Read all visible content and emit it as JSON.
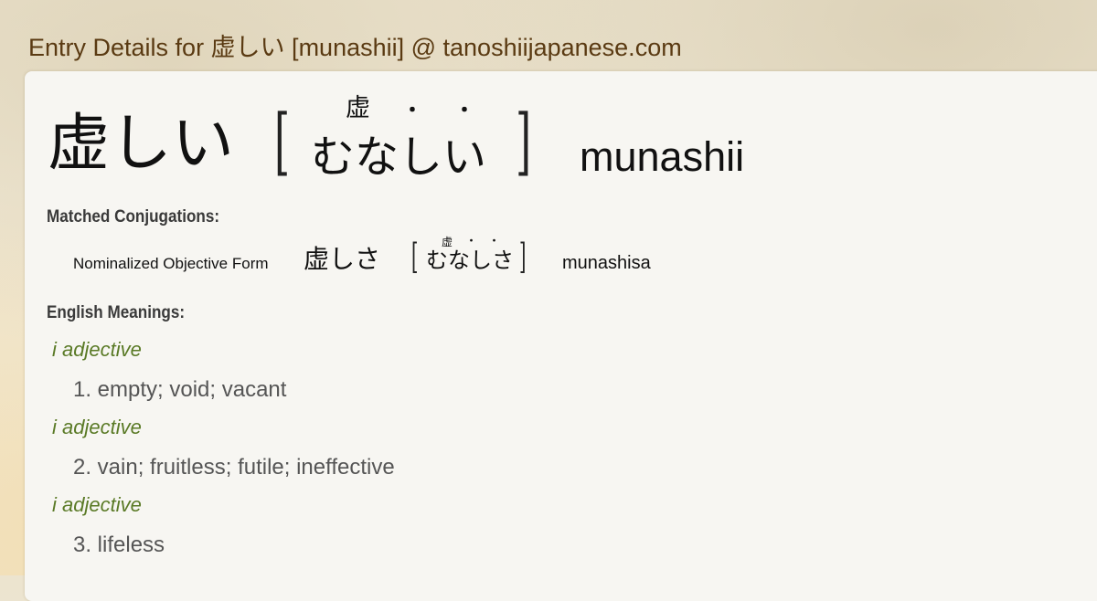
{
  "page": {
    "title": "Entry Details for 虚しい [munashii] @ tanoshiijapanese.com"
  },
  "entry": {
    "kanji": "虚しい",
    "reading": "むなしい",
    "furigana": {
      "kanji": "虚",
      "dot": "・"
    },
    "romaji": "munashii"
  },
  "conjugations": {
    "label": "Matched Conjugations:",
    "items": [
      {
        "form": "Nominalized Objective Form",
        "kanji": "虚しさ",
        "reading": "むなしさ",
        "furigana_kanji": "虚",
        "dot": "・",
        "romaji": "munashisa"
      }
    ]
  },
  "meanings": {
    "label": "English Meanings:",
    "items": [
      {
        "pos": "i adjective",
        "text": "1. empty; void; vacant"
      },
      {
        "pos": "i adjective",
        "text": "2. vain; fruitless; futile; ineffective"
      },
      {
        "pos": "i adjective",
        "text": "3. lifeless"
      }
    ]
  },
  "colors": {
    "title": "#5a3a12",
    "pos": "#5a7a26",
    "meaning": "#555555",
    "card": "#f7f6f2"
  },
  "brackets": {
    "open": "[",
    "close": "]"
  }
}
